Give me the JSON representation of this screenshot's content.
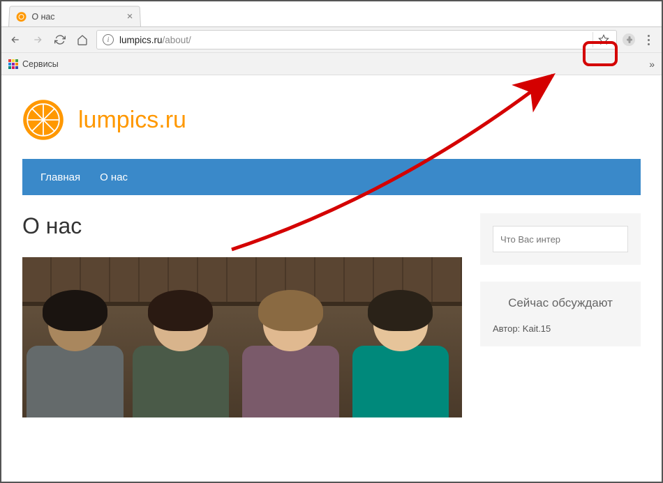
{
  "tab": {
    "title": "О нас"
  },
  "toolbar": {
    "url_host": "lumpics.ru",
    "url_path": "/about/"
  },
  "bookmarks": {
    "apps_label": "Сервисы"
  },
  "site": {
    "name": "lumpics.ru",
    "nav": [
      {
        "label": "Главная"
      },
      {
        "label": "О нас"
      }
    ]
  },
  "page": {
    "heading": "О нас"
  },
  "sidebar": {
    "search_placeholder": "Что Вас интер",
    "discuss_title": "Сейчас обсуждают",
    "discuss_author_label": "Автор: ",
    "discuss_author": "Kait.15"
  }
}
